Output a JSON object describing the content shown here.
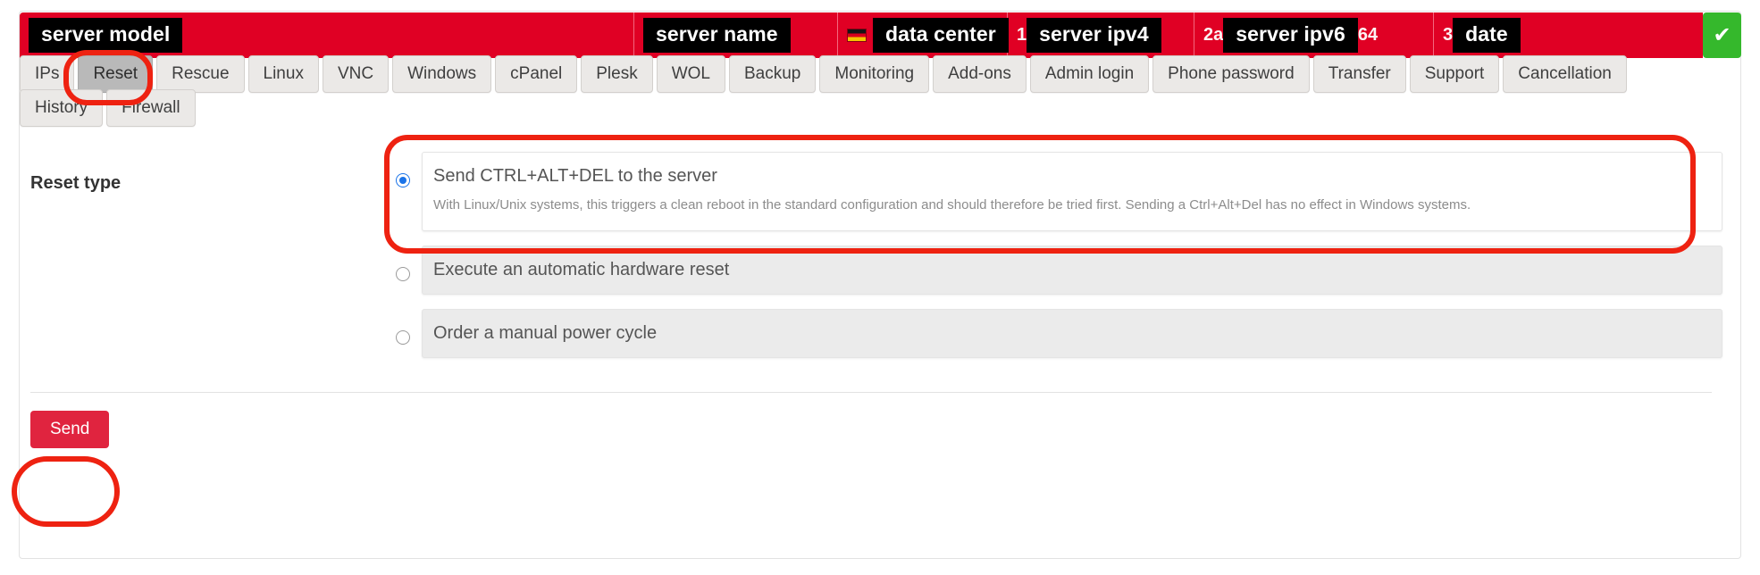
{
  "header": {
    "cells": [
      {
        "name": "server-model",
        "redacted_label": "server model",
        "prefix": "",
        "suffix": "",
        "flag": ""
      },
      {
        "name": "server-name",
        "redacted_label": "server name",
        "prefix": "",
        "suffix": "",
        "flag": ""
      },
      {
        "name": "data-center",
        "redacted_label": "data center",
        "prefix": "",
        "suffix": "",
        "flag": "de"
      },
      {
        "name": "server-ipv4",
        "redacted_label": "server ipv4",
        "prefix": "1",
        "suffix": "",
        "flag": ""
      },
      {
        "name": "server-ipv6",
        "redacted_label": "server ipv6",
        "prefix": "2a",
        "suffix": "64",
        "flag": ""
      },
      {
        "name": "date",
        "redacted_label": "date",
        "prefix": "3",
        "suffix": "",
        "flag": ""
      }
    ],
    "confirm_icon": "✔",
    "bar_color": "#e00024",
    "confirm_color": "#35b82c"
  },
  "tabs": {
    "row1": [
      "IPs",
      "Reset",
      "Rescue",
      "Linux",
      "VNC",
      "Windows",
      "cPanel",
      "Plesk",
      "WOL",
      "Backup",
      "Monitoring",
      "Add-ons",
      "Admin login",
      "Phone password",
      "Transfer",
      "Support",
      "Cancellation"
    ],
    "row2": [
      "History",
      "Firewall"
    ],
    "active": "Reset"
  },
  "form": {
    "label": "Reset type",
    "options": [
      {
        "title": "Send CTRL+ALT+DEL to the server",
        "description": "With Linux/Unix systems, this triggers a clean reboot in the standard configuration and should therefore be tried first. Sending a Ctrl+Alt+Del has no effect in Windows systems.",
        "selected": true
      },
      {
        "title": "Execute an automatic hardware reset",
        "description": "",
        "selected": false
      },
      {
        "title": "Order a manual power cycle",
        "description": "",
        "selected": false
      }
    ],
    "submit_label": "Send",
    "submit_color": "#e0243f"
  },
  "annotations": {
    "color": "#ee2211",
    "targets": [
      "Reset tab",
      "Send CTRL+ALT+DEL option",
      "Send button"
    ]
  }
}
